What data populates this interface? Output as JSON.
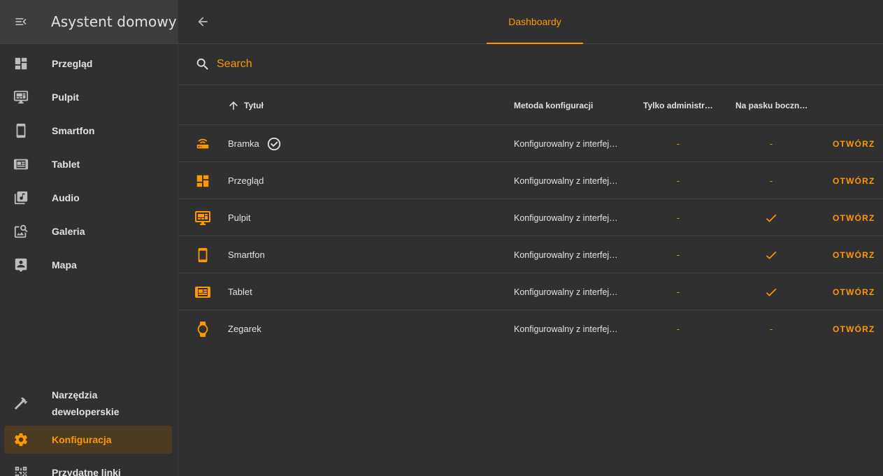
{
  "sidebar": {
    "title": "Asystent domowy",
    "items": [
      {
        "label": "Przegląd",
        "icon": "view-dashboard-icon"
      },
      {
        "label": "Pulpit",
        "icon": "monitor-dashboard-icon"
      },
      {
        "label": "Smartfon",
        "icon": "cellphone-icon"
      },
      {
        "label": "Tablet",
        "icon": "tablet-dashboard-icon"
      },
      {
        "label": "Audio",
        "icon": "music-library-icon"
      },
      {
        "label": "Galeria",
        "icon": "image-search-icon"
      },
      {
        "label": "Mapa",
        "icon": "account-box-icon"
      }
    ],
    "bottom_items": [
      {
        "label": "Narzędzia deweloperskie",
        "icon": "hammer-icon"
      },
      {
        "label": "Konfiguracja",
        "icon": "cog-icon",
        "active": true
      },
      {
        "label": "Przydatne linki",
        "icon": "qrcode-icon"
      }
    ]
  },
  "topbar": {
    "tab": "Dashboardy"
  },
  "search": {
    "placeholder": "Search"
  },
  "table": {
    "headers": {
      "title": "Tytuł",
      "method": "Metoda konfiguracji",
      "admin": "Tylko administr…",
      "sidebar": "Na pasku boczn…"
    },
    "open_label": "OTWÓRZ",
    "rows": [
      {
        "icon": "router-wireless-icon",
        "title": "Bramka",
        "default": true,
        "method": "Konfigurowalny z interfej…",
        "admin": "-",
        "sidebar": "-"
      },
      {
        "icon": "view-dashboard-icon",
        "title": "Przegląd",
        "default": false,
        "method": "Konfigurowalny z interfej…",
        "admin": "-",
        "sidebar": "-"
      },
      {
        "icon": "monitor-dashboard-icon",
        "title": "Pulpit",
        "default": false,
        "method": "Konfigurowalny z interfej…",
        "admin": "-",
        "sidebar": "check"
      },
      {
        "icon": "cellphone-icon",
        "title": "Smartfon",
        "default": false,
        "method": "Konfigurowalny z interfej…",
        "admin": "-",
        "sidebar": "check"
      },
      {
        "icon": "tablet-dashboard-icon",
        "title": "Tablet",
        "default": false,
        "method": "Konfigurowalny z interfej…",
        "admin": "-",
        "sidebar": "check"
      },
      {
        "icon": "watch-icon",
        "title": "Zegarek",
        "default": false,
        "method": "Konfigurowalny z interfej…",
        "admin": "-",
        "sidebar": "-"
      }
    ]
  },
  "colors": {
    "accent": "#ff9800",
    "background": "#303030",
    "header": "#3d3d3d",
    "active_bg": "#4b3b23",
    "text": "#e1e1e1"
  }
}
